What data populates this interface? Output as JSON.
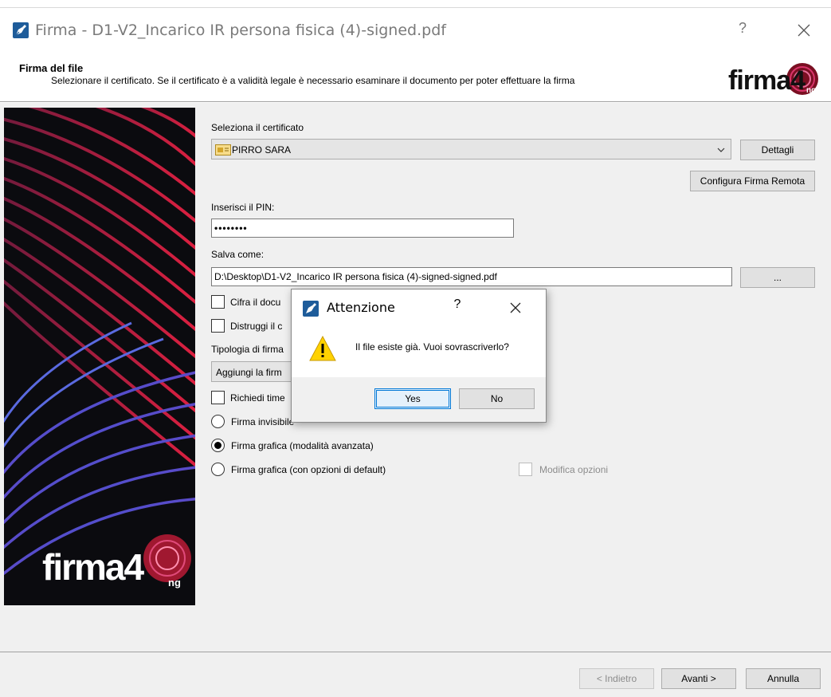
{
  "window": {
    "title": "Firma - D1-V2_Incarico IR persona fisica (4)-signed.pdf",
    "help_glyph": "?",
    "close_icon": "close-icon"
  },
  "header": {
    "title": "Firma del file",
    "subtitle": "Selezionare il certificato. Se il certificato è a validità legale è necessario esaminare il documento per poter effettuare la firma",
    "logo_text": "firma4",
    "logo_suffix": "ng"
  },
  "banner": {
    "logo_text": "firma4",
    "logo_suffix": "ng"
  },
  "form": {
    "certificate_label": "Seleziona il certificato",
    "certificate_value": "PIRRO SARA",
    "details_button": "Dettagli",
    "remote_button": "Configura Firma Remota",
    "pin_label": "Inserisci il PIN:",
    "pin_value": "••••••••",
    "save_label": "Salva come:",
    "save_value": "D:\\Desktop\\D1-V2_Incarico IR persona fisica (4)-signed-signed.pdf",
    "browse_button": "...",
    "encrypt_label": "Cifra il docu",
    "destroy_label": "Distruggi il c",
    "type_label": "Tipologia di firma",
    "type_value": "Aggiungi la firm",
    "timestamp_label": "Richiedi time",
    "radio_invisible": "Firma invisibile",
    "radio_advanced": "Firma grafica (modalità avanzata)",
    "radio_default": "Firma grafica (con opzioni di default)",
    "edit_options": "Modifica opzioni"
  },
  "footer": {
    "back_button": "< Indietro",
    "next_button": "Avanti >",
    "cancel_button": "Annulla"
  },
  "dialog": {
    "title": "Attenzione",
    "help_glyph": "?",
    "message": "Il file esiste già. Vuoi sovrascriverlo?",
    "yes_button": "Yes",
    "no_button": "No",
    "icon": "warning-icon"
  },
  "colors": {
    "accent_red": "#c8102e",
    "dialog_focus": "#0078d7",
    "warning_yellow": "#ffd200"
  }
}
